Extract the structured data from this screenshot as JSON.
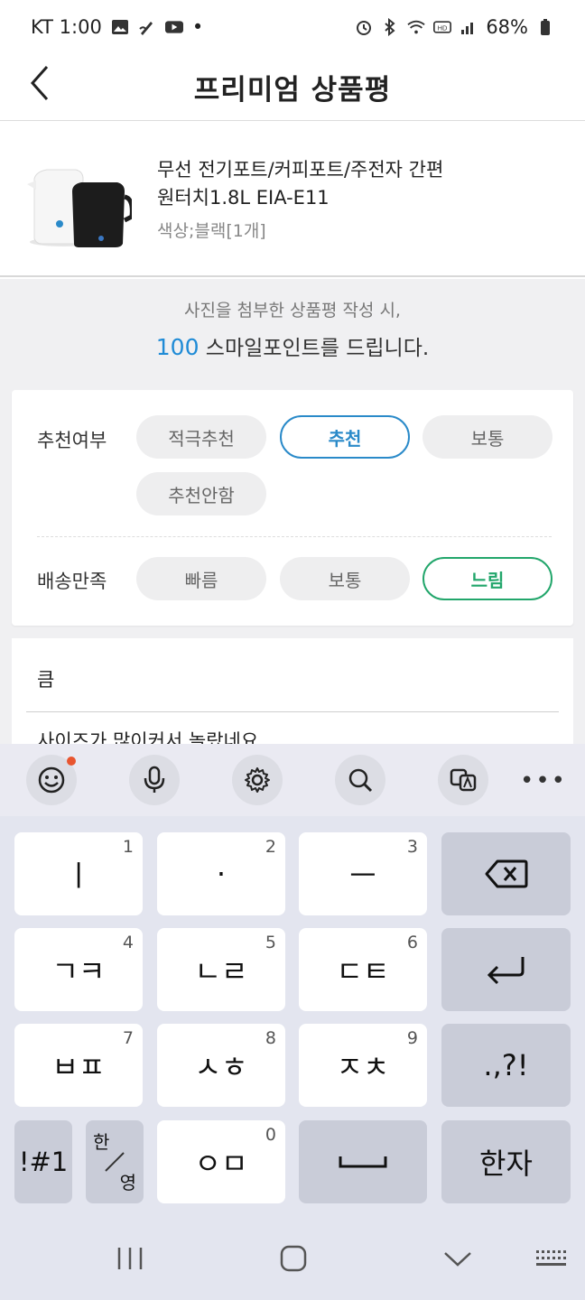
{
  "status_bar": {
    "carrier_time": "KT 1:00",
    "dot": "•",
    "battery": "68%"
  },
  "header": {
    "title": "프리미엄 상품평"
  },
  "product": {
    "name": "무선 전기포트/커피포트/주전자 간편원터치1.8L EIA-E11",
    "option": "색상;블랙[1개]"
  },
  "notice": {
    "line1": "사진을 첨부한 상품평 작성 시,",
    "points": "100",
    "line2_rest": " 스마일포인트를 드립니다."
  },
  "ratings": {
    "recommend": {
      "label": "추천여부",
      "options": [
        "적극추천",
        "추천",
        "보통",
        "추천안함"
      ],
      "selected": "추천"
    },
    "delivery": {
      "label": "배송만족",
      "options": [
        "빠름",
        "보통",
        "느림"
      ],
      "selected": "느림"
    }
  },
  "review": {
    "title": "큼",
    "body": "사이즈가 많이커서 놀랐네요"
  },
  "keyboard": {
    "toolbar_more": "•••",
    "rows": [
      [
        {
          "label": "ㅣ",
          "num": "1"
        },
        {
          "label": "·",
          "num": "2"
        },
        {
          "label": "ㅡ",
          "num": "3"
        }
      ],
      [
        {
          "label": "ㄱㅋ",
          "num": "4"
        },
        {
          "label": "ㄴㄹ",
          "num": "5"
        },
        {
          "label": "ㄷㅌ",
          "num": "6"
        }
      ],
      [
        {
          "label": "ㅂㅍ",
          "num": "7"
        },
        {
          "label": "ㅅㅎ",
          "num": "8"
        },
        {
          "label": "ㅈㅊ",
          "num": "9"
        }
      ]
    ],
    "punct": ".,?!",
    "sym": "!#1",
    "lang_top": "한",
    "lang_bottom": "영",
    "om_label": "ㅇㅁ",
    "om_num": "0",
    "hanja": "한자"
  },
  "colors": {
    "accent_blue": "#2a8ac9",
    "accent_green": "#22a66b",
    "points_blue": "#1f8bd6"
  }
}
